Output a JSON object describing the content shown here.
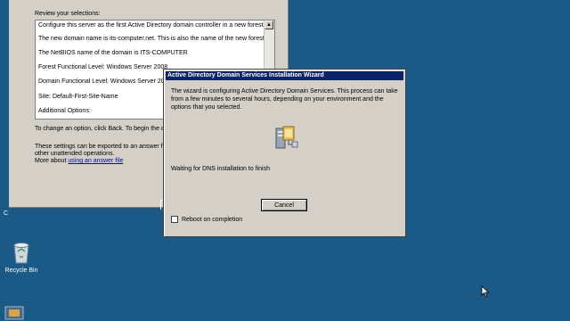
{
  "background_window": {
    "heading": "Review your selections:",
    "summary_lines": [
      "Configure this server as the first Active Directory domain controller in a new forest.",
      "The new domain name is its-computer.net. This is also the name of the new forest.",
      "The NetBIOS name of the domain is ITS-COMPUTER",
      "Forest Functional Level: Windows Server 2008",
      "Domain Functional Level: Windows Server 2008",
      "Site: Default-First-Site-Name",
      "Additional Options:"
    ],
    "change_text": "To change an option, click Back. To begin the o",
    "export_line1": "These settings can be exported to an answer file",
    "export_line2": "other unattended operations.",
    "more_about": "More about",
    "answer_file_link": "using an answer file"
  },
  "dialog": {
    "title": "Active Directory Domain Services Installation Wizard",
    "message": "The wizard is configuring Active Directory Domain Services. This process can take from a few minutes to several hours, depending on your environment and the options that you selected.",
    "status": "Waiting for DNS installation to finish",
    "cancel_label": "Cancel",
    "reboot_label": "Reboot on completion",
    "reboot_checked": false
  },
  "desktop": {
    "recycle_bin_label": "Recycle Bin",
    "left_edge_char": "C"
  },
  "colors": {
    "desktop": "#1b5a86",
    "titlebar": "#0a246a",
    "window_face": "#d4d0c8",
    "link": "#0000cc"
  }
}
